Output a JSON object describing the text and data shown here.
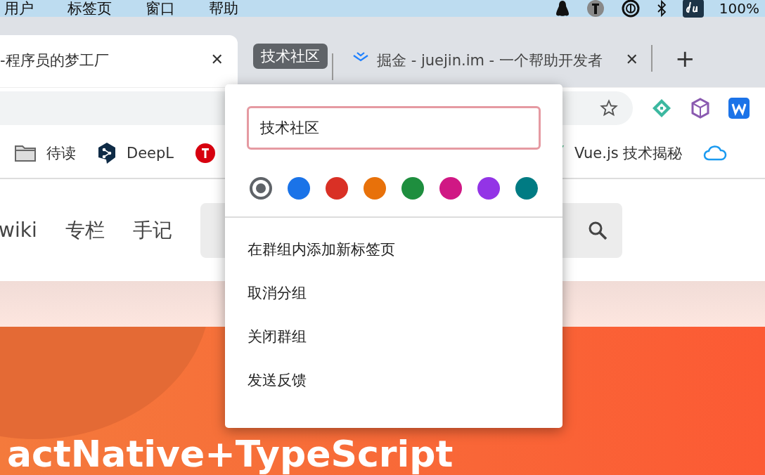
{
  "menu_bar": {
    "items": [
      "用户",
      "标签页",
      "窗口",
      "帮助"
    ],
    "battery": "100%"
  },
  "tab_close": "✕",
  "new_tab": "+",
  "tabs": [
    {
      "kind": "tab",
      "title": "-程序员的梦工厂",
      "selected": true
    },
    {
      "kind": "group",
      "title": "技术社区",
      "selected": false
    },
    {
      "kind": "tab",
      "title": "掘金 - juejin.im - 一个帮助开发者",
      "selected": false
    }
  ],
  "bookmarks": [
    {
      "kind": "folder",
      "label": "待读"
    },
    {
      "kind": "deepl",
      "label": "DeepL"
    },
    {
      "kind": "red"
    },
    {
      "kind": "vue",
      "label": "Vue.js 技术揭秘"
    }
  ],
  "site_nav": [
    "wiki",
    "专栏",
    "手记"
  ],
  "banner": {
    "title": "actNative+TypeScript"
  },
  "group_editor": {
    "name": "技术社区",
    "colors": [
      {
        "color": "#5f6368",
        "selected": true
      },
      {
        "color": "#1a73e8",
        "selected": false
      },
      {
        "color": "#d93025",
        "selected": false
      },
      {
        "color": "#e8710a",
        "selected": false
      },
      {
        "color": "#1e8e3e",
        "selected": false
      },
      {
        "color": "#d01884",
        "selected": false
      },
      {
        "color": "#9334e6",
        "selected": false
      },
      {
        "color": "#007b83",
        "selected": false
      }
    ],
    "actions": [
      "在群组内添加新标签页",
      "取消分组",
      "关闭群组",
      "发送反馈"
    ]
  }
}
